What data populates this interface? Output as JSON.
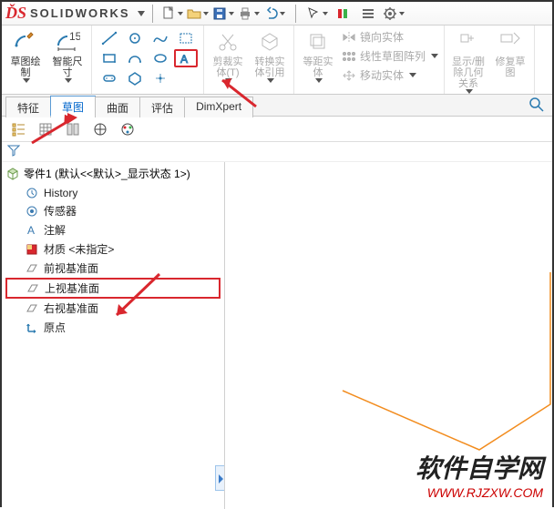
{
  "app": {
    "brand": "SOLIDWORKS"
  },
  "ribbon": {
    "group1": {
      "sketch": "草图绘制",
      "dim": "智能尺寸"
    },
    "group3": {
      "trim": "剪裁实体(T)",
      "convert": "转换实体引用"
    },
    "group4": {
      "offset": "等距实体",
      "mirror": "镜向实体",
      "pattern": "线性草图阵列",
      "move": "移动实体"
    },
    "group5": {
      "showhide": "显示/删除几何关系",
      "repair": "修复草图"
    }
  },
  "tabs": {
    "feature": "特征",
    "sketch": "草图",
    "surface": "曲面",
    "evaluate": "评估",
    "dimxpert": "DimXpert"
  },
  "tree": {
    "root": "零件1 (默认<<默认>_显示状态 1>)",
    "history": "History",
    "sensors": "传感器",
    "annotations": "注解",
    "material": "材质 <未指定>",
    "front": "前视基准面",
    "top": "上视基准面",
    "right": "右视基准面",
    "origin": "原点"
  },
  "watermark": {
    "cn": "软件自学网",
    "url": "WWW.RJZXW.COM"
  }
}
